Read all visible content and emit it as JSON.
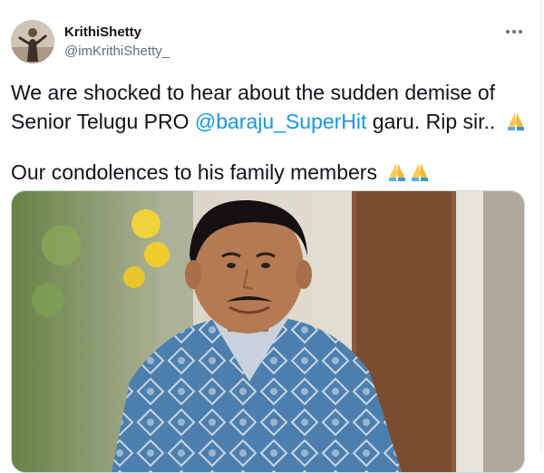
{
  "tweet": {
    "author": {
      "display_name": "KrithiShetty",
      "handle": "@imKrithiShetty_"
    },
    "more_icon": "more-horizontal-icon",
    "text": {
      "line1_before_mention": "We are shocked to hear about the sudden demise of Senior Telugu PRO ",
      "mention": "@baraju_SuperHit",
      "line1_after_mention": " garu. Rip sir..",
      "line2": "Our condolences to his family members",
      "emoji": "folded-hands-icon"
    },
    "media": {
      "description": "photo of a smiling man in a blue patterned shirt"
    },
    "colors": {
      "link": "#1b95e0",
      "secondary_text": "#5b7083",
      "border": "#cfd9de"
    }
  }
}
